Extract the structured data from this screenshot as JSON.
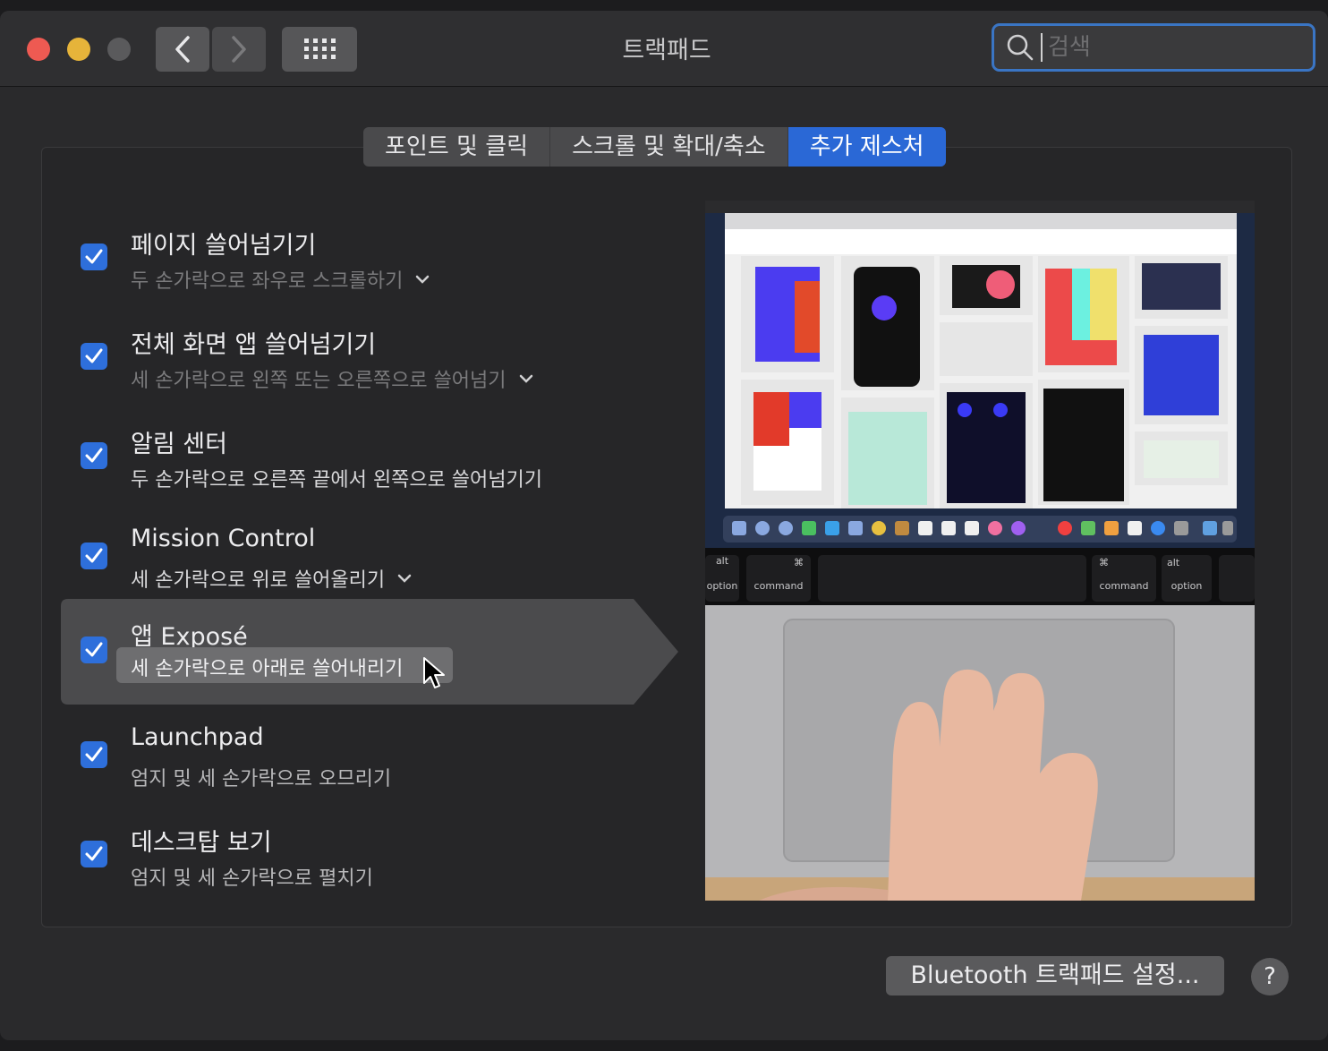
{
  "window": {
    "title": "트랙패드",
    "search_placeholder": "검색"
  },
  "tabs": [
    {
      "label": "포인트 및 클릭",
      "active": false
    },
    {
      "label": "스크롤 및 확대/축소",
      "active": false
    },
    {
      "label": "추가 제스처",
      "active": true
    }
  ],
  "gestures": [
    {
      "title": "페이지 쓸어넘기기",
      "subtitle": "두 손가락으로 좌우로 스크롤하기",
      "checked": true,
      "dropdown": true
    },
    {
      "title": "전체 화면 앱 쓸어넘기기",
      "subtitle": "세 손가락으로 왼쪽 또는 오른쪽으로 쓸어넘기",
      "checked": true,
      "dropdown": true
    },
    {
      "title": "알림 센터",
      "subtitle": "두 손가락으로 오른쪽 끝에서 왼쪽으로 쓸어넘기기",
      "checked": true,
      "dropdown": false
    },
    {
      "title": "Mission Control",
      "subtitle": "세 손가락으로 위로 쓸어올리기",
      "checked": true,
      "dropdown": true
    },
    {
      "title": "앱 Exposé",
      "subtitle": "세 손가락으로 아래로 쓸어내리기",
      "checked": true,
      "dropdown": true,
      "selected": true
    },
    {
      "title": "Launchpad",
      "subtitle": "엄지 및 세 손가락으로 오므리기",
      "checked": true,
      "dropdown": false
    },
    {
      "title": "데스크탑 보기",
      "subtitle": "엄지 및 세 손가락으로 펼치기",
      "checked": true,
      "dropdown": false
    }
  ],
  "preview": {
    "keys": [
      "alt",
      "option",
      "⌘",
      "command",
      "⌘",
      "command",
      "alt",
      "option"
    ]
  },
  "footer": {
    "bluetooth_button": "Bluetooth 트랙패드 설정...",
    "help": "?"
  },
  "colors": {
    "accent": "#2a68d6",
    "checkbox": "#2e6fdb",
    "close": "#ee5a52",
    "minimize": "#e6b43a"
  }
}
